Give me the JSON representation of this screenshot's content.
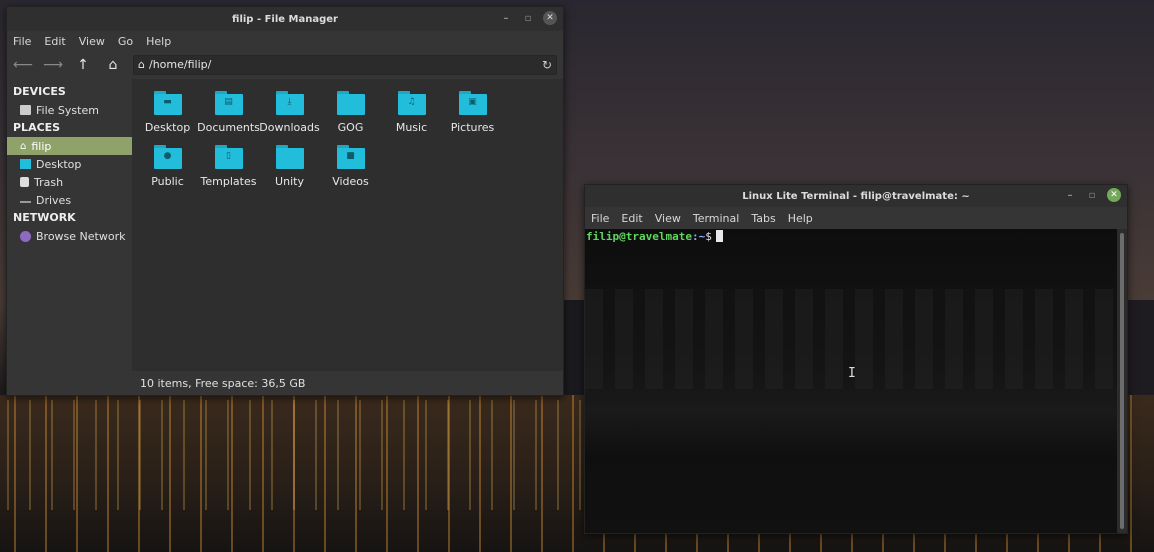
{
  "file_manager": {
    "title": "filip - File Manager",
    "menu": [
      "File",
      "Edit",
      "View",
      "Go",
      "Help"
    ],
    "path": "/home/filip/",
    "sidebar": {
      "devices_header": "DEVICES",
      "devices": [
        {
          "label": "File System",
          "icon": "drive-icon"
        }
      ],
      "places_header": "PLACES",
      "places": [
        {
          "label": "filip",
          "icon": "home-icon",
          "selected": true
        },
        {
          "label": "Desktop",
          "icon": "desktop-icon"
        },
        {
          "label": "Trash",
          "icon": "trash-icon"
        },
        {
          "label": "Drives",
          "icon": "drives-icon"
        }
      ],
      "network_header": "NETWORK",
      "network": [
        {
          "label": "Browse Network",
          "icon": "network-icon"
        }
      ]
    },
    "items": [
      {
        "label": "Desktop",
        "glyph": "▬"
      },
      {
        "label": "Documents",
        "glyph": "▤"
      },
      {
        "label": "Downloads",
        "glyph": "⤓"
      },
      {
        "label": "GOG",
        "glyph": ""
      },
      {
        "label": "Music",
        "glyph": "♫"
      },
      {
        "label": "Pictures",
        "glyph": "▣"
      },
      {
        "label": "Public",
        "glyph": "●"
      },
      {
        "label": "Templates",
        "glyph": "▯"
      },
      {
        "label": "Unity",
        "glyph": ""
      },
      {
        "label": "Videos",
        "glyph": "■"
      }
    ],
    "status": "10 items, Free space: 36,5 GB"
  },
  "terminal": {
    "title": "Linux Lite Terminal - filip@travelmate: ~",
    "menu": [
      "File",
      "Edit",
      "View",
      "Terminal",
      "Tabs",
      "Help"
    ],
    "prompt_user": "filip@travelmate",
    "prompt_path": ":~",
    "prompt_sign": "$"
  },
  "colors": {
    "folder": "#23bddc",
    "selection": "#8ea26a",
    "prompt_user": "#5fd75f",
    "prompt_path": "#87afff"
  }
}
